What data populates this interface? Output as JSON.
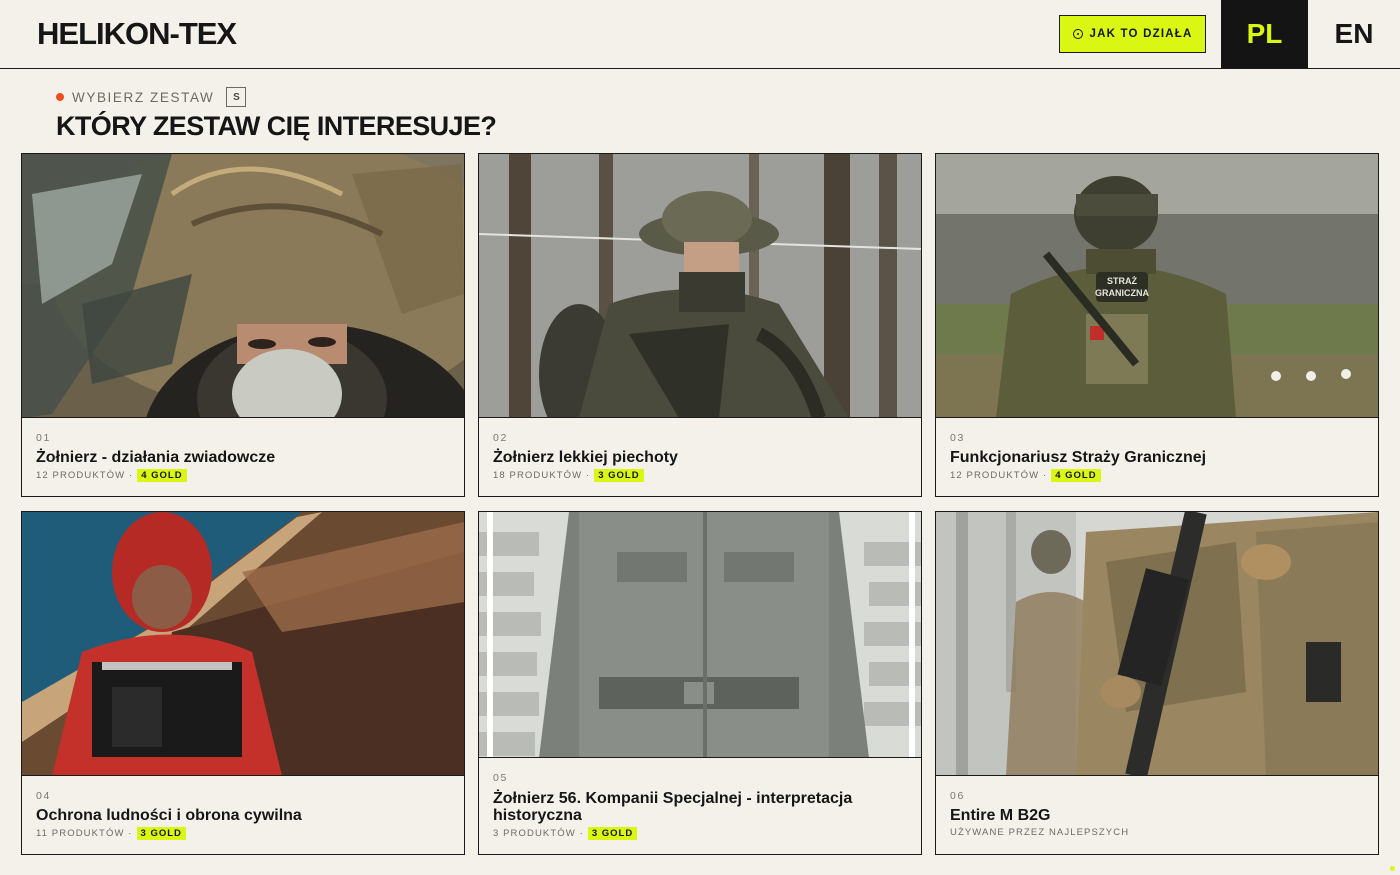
{
  "header": {
    "brand": "HELIKON-TEX",
    "how_it_works": "JAK TO DZIAŁA",
    "lang_pl": "PL",
    "lang_en": "EN",
    "accent_color": "#d9f713"
  },
  "section": {
    "eyebrow": "WYBIERZ ZESTAW",
    "shortcut_key": "S",
    "title": "KTÓRY ZESTAW CIĘ INTERESUJE?"
  },
  "cards": [
    {
      "num": "01",
      "title": "Żołnierz - działania zwiadowcze",
      "count": "12 PRODUKTÓW ·",
      "badge": "4 GOLD",
      "image": "camouflaged-scout-photo"
    },
    {
      "num": "02",
      "title": "Żołnierz lekkiej piechoty",
      "count": "18 PRODUKTÓW ·",
      "badge": "3 GOLD",
      "image": "infantry-soldier-forest-photo"
    },
    {
      "num": "03",
      "title": "Funkcjonariusz Straży Granicznej",
      "count": "12 PRODUKTÓW ·",
      "badge": "4 GOLD",
      "image": "border-guard-back-photo"
    },
    {
      "num": "04",
      "title": "Ochrona ludności i obrona cywilna",
      "count": "11 PRODUKTÓW ·",
      "badge": "3 GOLD",
      "image": "civil-defence-red-jacket-photo"
    },
    {
      "num": "05",
      "title": "Żołnierz 56. Kompanii Specjalnej - interpretacja historyczna",
      "count": "3 PRODUKTÓW ·",
      "badge": "3 GOLD",
      "image": "historical-uniform-photo"
    },
    {
      "num": "06",
      "title": "Entire M B2G",
      "count": "UŻYWANE PRZEZ NAJLEPSZYCH",
      "badge": "",
      "image": "soldier-rifle-snow-photo"
    }
  ]
}
